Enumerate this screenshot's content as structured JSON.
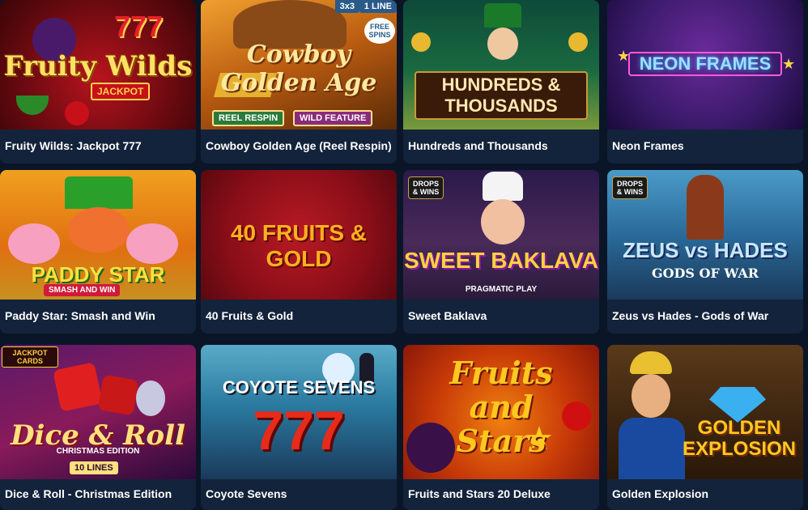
{
  "games": [
    {
      "name": "Fruity Wilds: Jackpot 777",
      "art_title": "Fruity Wilds",
      "art_sub": "JACKPOT",
      "art_num": "777"
    },
    {
      "name": "Cowboy Golden Age (Reel Respin)",
      "art_title": "Cowboy Golden Age",
      "badge_grid": "3x3",
      "badge_line": "1 LINE",
      "badge_free": "FREE SPINS",
      "badge_respin": "REEL RESPIN",
      "badge_wild": "WILD FEATURE"
    },
    {
      "name": "Hundreds and Thousands",
      "art_title": "HUNDREDS & THOUSANDS"
    },
    {
      "name": "Neon Frames",
      "art_title": "NEON FRAMES"
    },
    {
      "name": "Paddy Star: Smash and Win",
      "art_title": "PADDY STAR",
      "art_sub": "SMASH AND WIN"
    },
    {
      "name": "40 Fruits & Gold",
      "art_title": "40 FRUITS & GOLD"
    },
    {
      "name": "Sweet Baklava",
      "art_title": "SWEET BAKLAVA",
      "art_sub": "PRAGMATIC PLAY",
      "drops": "DROPS & WINS"
    },
    {
      "name": "Zeus vs Hades - Gods of War",
      "art_title": "ZEUS vs HADES",
      "art_sub": "GODS OF WAR",
      "drops": "DROPS & WINS"
    },
    {
      "name": "Dice & Roll - Christmas Edition",
      "art_title": "Dice & Roll",
      "art_sub": "CHRISTMAS EDITION",
      "art_lines": "10 LINES",
      "art_badge": "JACKPOT CARDS"
    },
    {
      "name": "Coyote Sevens",
      "art_title": "COYOTE SEVENS",
      "art_num": "777"
    },
    {
      "name": "Fruits and Stars 20 Deluxe",
      "art_title": "Fruits and Stars"
    },
    {
      "name": "Golden Explosion",
      "art_title": "GOLDEN EXPLOSION"
    }
  ]
}
